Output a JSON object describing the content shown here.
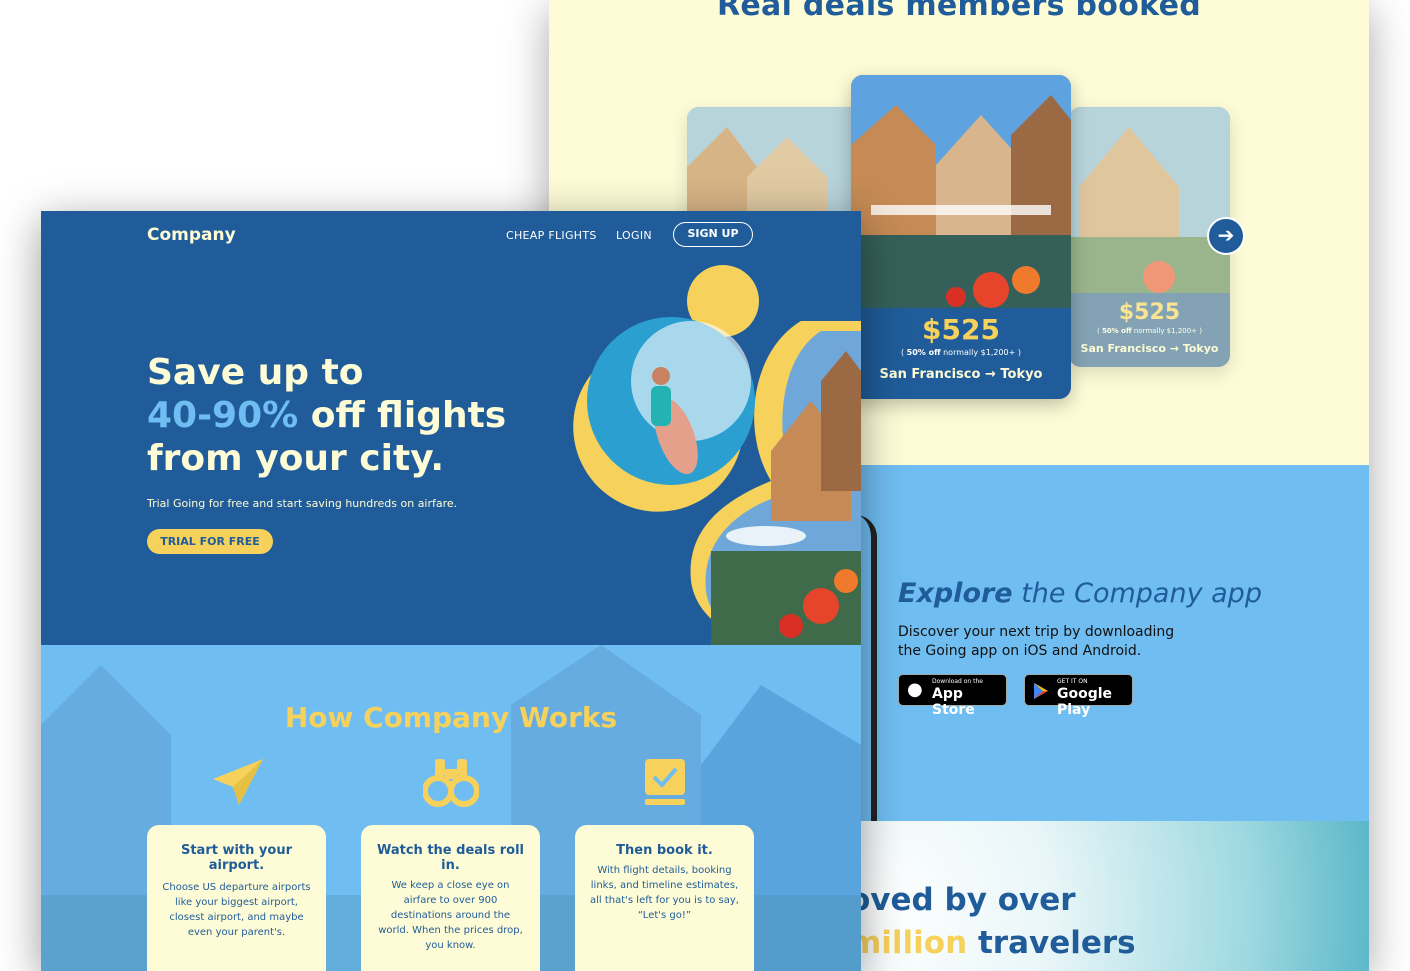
{
  "deals": {
    "title": "Real deals members booked",
    "cards": [
      {
        "price": "$525",
        "discount": "50% off",
        "normally": "normally $1,200+",
        "route": "San Francisco → Tokyo"
      },
      {
        "price": "$525",
        "discount": "50% off",
        "normally": "normally $1,200+",
        "route": "San Francisco → Tokyo"
      }
    ],
    "next_icon": "arrow-right-icon"
  },
  "app": {
    "title_em": "Explore",
    "title_rest": " the Company app",
    "description": "Discover your next trip by downloading the Going app on iOS and Android.",
    "app_store": {
      "small": "Download on the",
      "big": "App Store"
    },
    "google_play": {
      "small": "GET IT ON",
      "big": "Google Play"
    }
  },
  "loved": {
    "line1": "oved by over",
    "line2_hl": "million",
    "line2_rest": " travelers"
  },
  "nav": {
    "logo": "Company",
    "cheap_flights": "CHEAP FLIGHTS",
    "login": "LOGIN",
    "signup": "SIGN UP"
  },
  "hero": {
    "line1": "Save up to",
    "line2_hl": "40-90%",
    "line2_rest": " off flights",
    "line3": "from your city.",
    "subtitle": "Trial Going for free and start saving hundreds on airfare.",
    "cta": "TRIAL FOR FREE"
  },
  "how": {
    "title": "How Company Works",
    "steps": [
      {
        "icon": "paper-plane-icon",
        "title": "Start with your airport.",
        "text": "Choose US departure airports like your biggest airport, closest airport, and maybe even your parent's."
      },
      {
        "icon": "binoculars-icon",
        "title": "Watch the deals roll in.",
        "text": "We keep a close eye on airfare to over 900 destinations around the world. When the prices drop, you know."
      },
      {
        "icon": "book-check-icon",
        "title": "Then book it.",
        "text": "With flight details, booking links, and timeline estimates, all that's left for you is to say, “Let's go!”"
      }
    ]
  },
  "colors": {
    "navy": "#1f5c99",
    "sky": "#6fbdf1",
    "yellow": "#f6d15c",
    "cream": "#fefcd6"
  }
}
